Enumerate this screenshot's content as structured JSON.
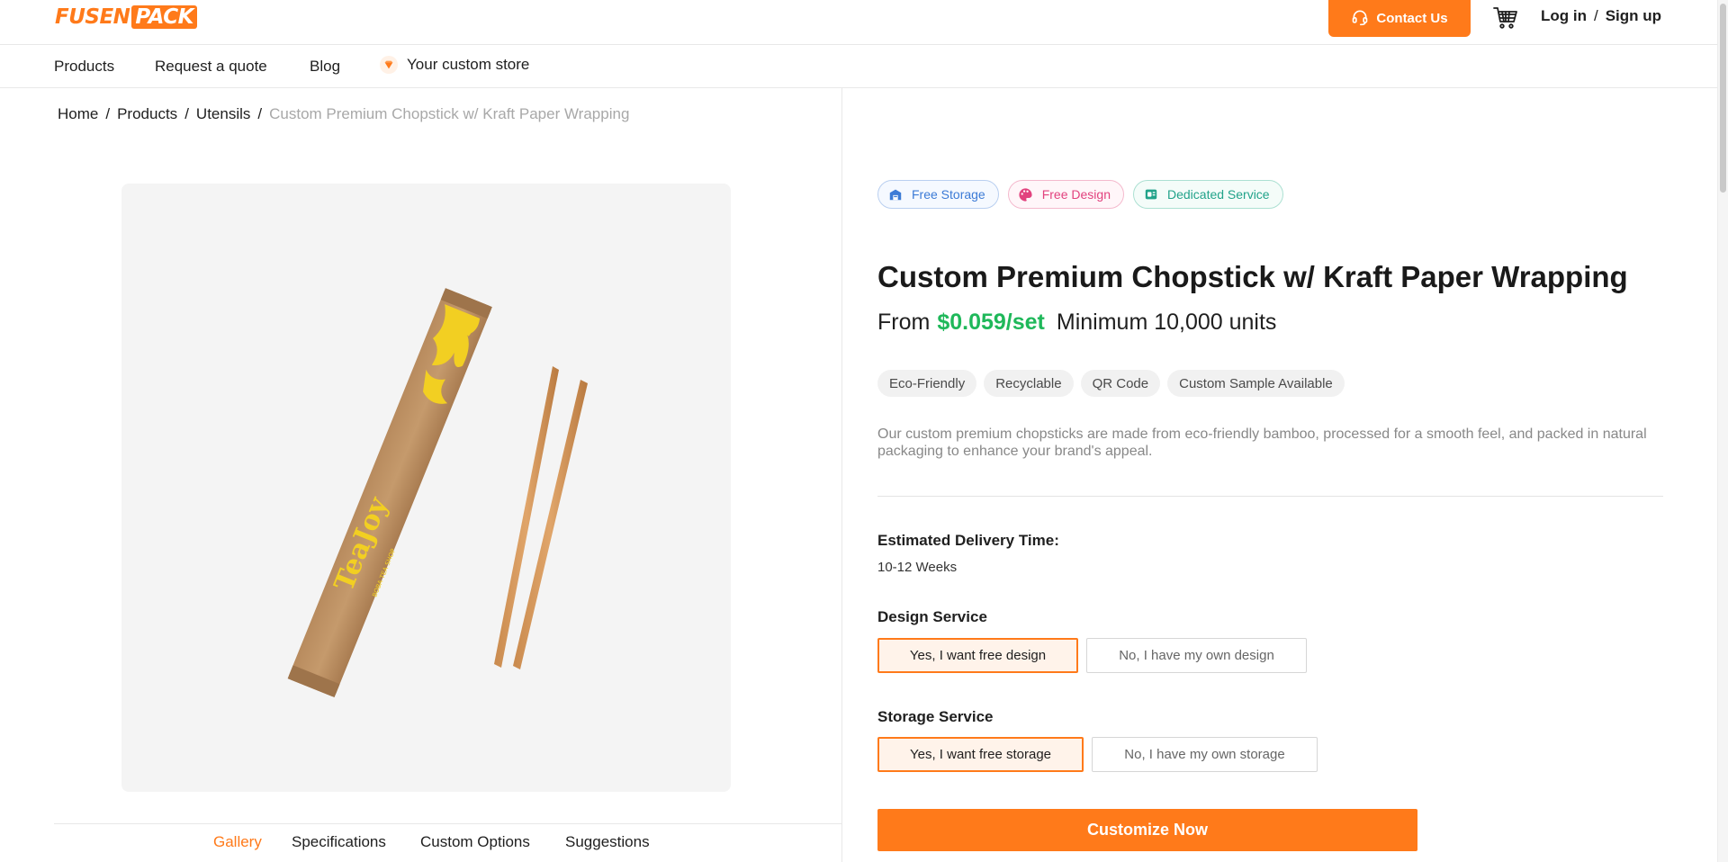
{
  "header": {
    "logo_left": "FUSEN",
    "logo_right": "PACK",
    "contact_label": "Contact Us",
    "login_label": "Log in",
    "separator": "/",
    "signup_label": "Sign up"
  },
  "nav": {
    "items": [
      "Products",
      "Request a quote",
      "Blog",
      "Your custom store"
    ]
  },
  "breadcrumb": {
    "items": [
      "Home",
      "Products",
      "Utensils"
    ],
    "separator": "/",
    "current": "Custom Premium Chopstick w/ Kraft Paper Wrapping"
  },
  "gallery": {
    "brand_text": "TeaJoy",
    "sub_text": "BOBA TEA SHOP",
    "tabs": [
      "Gallery",
      "Specifications",
      "Custom Options",
      "Suggestions"
    ]
  },
  "product": {
    "badges": [
      "Free Storage",
      "Free Design",
      "Dedicated Service"
    ],
    "title": "Custom Premium Chopstick w/ Kraft Paper Wrapping",
    "price_prefix": "From",
    "price": "$0.059/set",
    "minimum": "Minimum 10,000 units",
    "tags": [
      "Eco-Friendly",
      "Recyclable",
      "QR Code",
      "Custom Sample Available"
    ],
    "description": "Our custom premium chopsticks are made from eco-friendly bamboo, processed for a smooth feel, and packed in natural packaging to enhance your brand's appeal.",
    "delivery_label": "Estimated Delivery Time:",
    "delivery_value": "10-12 Weeks",
    "design_label": "Design Service",
    "design_yes": "Yes, I want free design",
    "design_no": "No, I have my own design",
    "storage_label": "Storage Service",
    "storage_yes": "Yes, I want free storage",
    "storage_no": "No, I have my own storage",
    "cta_label": "Customize Now"
  },
  "colors": {
    "accent": "#ff7a1a",
    "price": "#1fb85a",
    "storage_badge": "#3c7bd6",
    "design_badge": "#e2427e",
    "service_badge": "#22a38a"
  },
  "icons": [
    "headset-icon",
    "cart-icon",
    "diamond-icon",
    "storage-icon",
    "palette-icon",
    "service-icon"
  ]
}
